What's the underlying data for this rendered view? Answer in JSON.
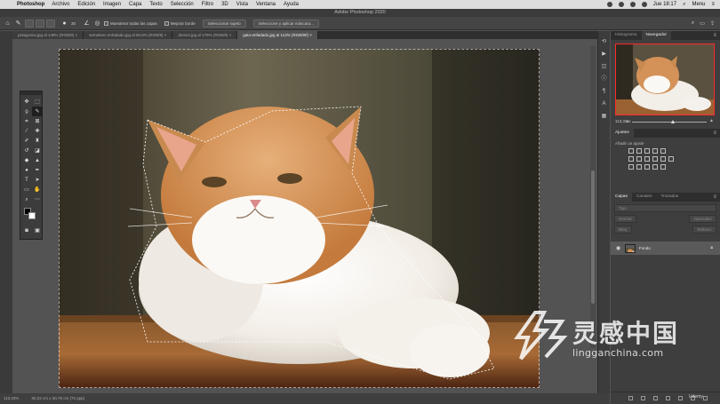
{
  "menubar": {
    "app_name": "Photoshop",
    "items": [
      "Archivo",
      "Edición",
      "Imagen",
      "Capa",
      "Texto",
      "Selección",
      "Filtro",
      "3D",
      "Vista",
      "Ventana",
      "Ayuda"
    ],
    "clock": "Jue 18:17",
    "menu_label": "Menu"
  },
  "window": {
    "title": "Adobe Photoshop 2020"
  },
  "options": {
    "brush_size": "30",
    "sample_all_layers": "Muestrear todas las capas",
    "enhance_edge": "Mejorar borde",
    "select_subject": "Seleccionar sujeto",
    "select_and_mask": "Seleccione y aplicar máscara..."
  },
  "tabs": [
    {
      "label": "pelagomia.jpg al 149% (RGB/8) ×"
    },
    {
      "label": "semeleen enfadado.jpg al 50,8% (RGB/8) ×"
    },
    {
      "label": "dress4.jpg al 176% (RGB/8) ×"
    },
    {
      "label": "gato-enfadado.jpg al 113% (RGB/8#) ×",
      "active": true
    }
  ],
  "status": {
    "zoom": "113,33%",
    "doc_info": "80,23 cm x 30,78 cm (72 ppp)"
  },
  "navigator": {
    "tabs": [
      "Histograma",
      "Navegador"
    ],
    "zoom": "113,33%"
  },
  "adjustments": {
    "tab": "Ajustes",
    "label": "Añadir un ajuste"
  },
  "layers": {
    "tabs": [
      "Capas",
      "Canales",
      "Trazados"
    ],
    "filter_placeholder": "Tipo",
    "blend_mode": "Normal",
    "opacity_label": "Opacidad:",
    "lock_label": "Bloq:",
    "fill_label": "Relleno:",
    "items": [
      {
        "name": "Fondo"
      }
    ]
  },
  "watermark": {
    "cn": "灵感中国",
    "en": "lingganchina.com",
    "udemy": "Udemy"
  }
}
